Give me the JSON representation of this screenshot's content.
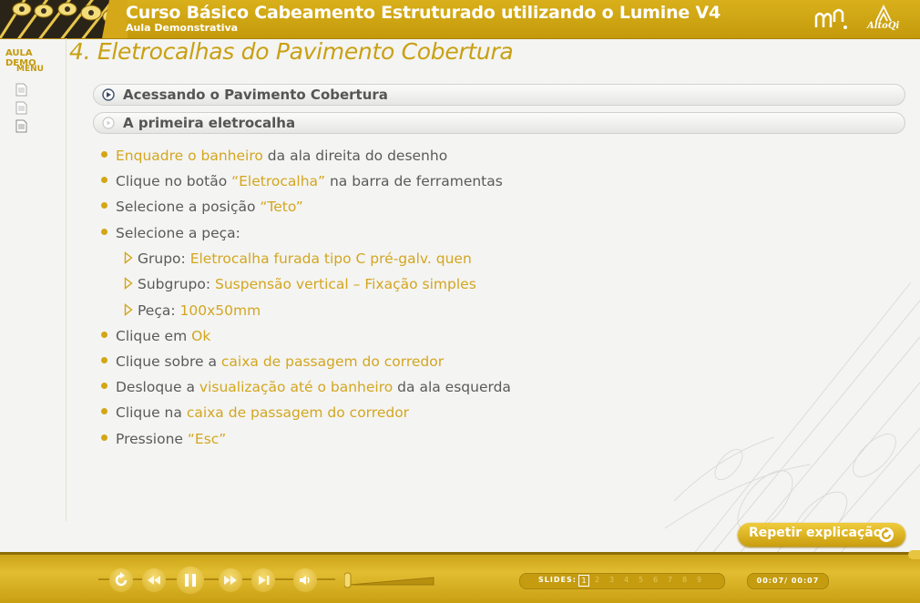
{
  "header": {
    "title": "Curso Básico Cabeamento Estruturado utilizando o Lumine V4",
    "subtitle": "Aula Demonstrativa",
    "brand": "AltoQi"
  },
  "sidebar": {
    "aula": "AULA DEMO",
    "menu": "MENU",
    "docs": [
      "doc-icon-1",
      "doc-icon-2",
      "doc-icon-3"
    ]
  },
  "page": {
    "title": "4. Eletrocalhas do Pavimento Cobertura",
    "sections": [
      {
        "label": "Acessando o Pavimento Cobertura"
      },
      {
        "label": "A primeira eletrocalha"
      }
    ]
  },
  "bullets": [
    {
      "parts": [
        {
          "t": "Enquadre o banheiro",
          "hl": true
        },
        {
          "t": " da ala direita do desenho"
        }
      ]
    },
    {
      "parts": [
        {
          "t": "Clique no botão "
        },
        {
          "t": "“Eletrocalha”",
          "hl": true
        },
        {
          "t": " na barra de ferramentas"
        }
      ]
    },
    {
      "parts": [
        {
          "t": "Selecione a posição "
        },
        {
          "t": "“Teto”",
          "hl": true
        }
      ]
    },
    {
      "parts": [
        {
          "t": "Selecione a peça:"
        }
      ]
    },
    {
      "sub": true,
      "parts": [
        {
          "t": "Grupo: "
        },
        {
          "t": "Eletrocalha furada tipo C pré-galv. quen",
          "hl": true
        }
      ]
    },
    {
      "sub": true,
      "parts": [
        {
          "t": "Subgrupo: "
        },
        {
          "t": "Suspensão vertical – Fixação simples",
          "hl": true
        }
      ]
    },
    {
      "sub": true,
      "parts": [
        {
          "t": "Peça: "
        },
        {
          "t": "100x50mm",
          "hl": true
        }
      ]
    },
    {
      "parts": [
        {
          "t": "Clique em "
        },
        {
          "t": "Ok",
          "hl": true
        }
      ]
    },
    {
      "parts": [
        {
          "t": "Clique sobre a "
        },
        {
          "t": "caixa de passagem do corredor",
          "hl": true
        }
      ]
    },
    {
      "parts": [
        {
          "t": "Desloque a "
        },
        {
          "t": "visualização até o banheiro",
          "hl": true
        },
        {
          "t": " da ala esquerda"
        }
      ]
    },
    {
      "parts": [
        {
          "t": "Clique na "
        },
        {
          "t": "caixa de passagem do corredor",
          "hl": true
        }
      ]
    },
    {
      "parts": [
        {
          "t": "Pressione "
        },
        {
          "t": "“Esc”",
          "hl": true
        }
      ]
    }
  ],
  "repeat_button": "Repetir explicação",
  "player": {
    "controls": [
      "replay-icon",
      "rewind-icon",
      "pause-icon",
      "forward-icon",
      "next-icon",
      "volume-icon"
    ],
    "slides_label": "SLIDES:",
    "current_slide": "1",
    "other_slides": [
      "2",
      "3",
      "4",
      "5",
      "6",
      "7",
      "8",
      "9"
    ],
    "time": "00:07/ 00:07"
  },
  "colors": {
    "accent": "#c9a012",
    "highlight": "#d3a620",
    "text": "#5a5a5a"
  }
}
